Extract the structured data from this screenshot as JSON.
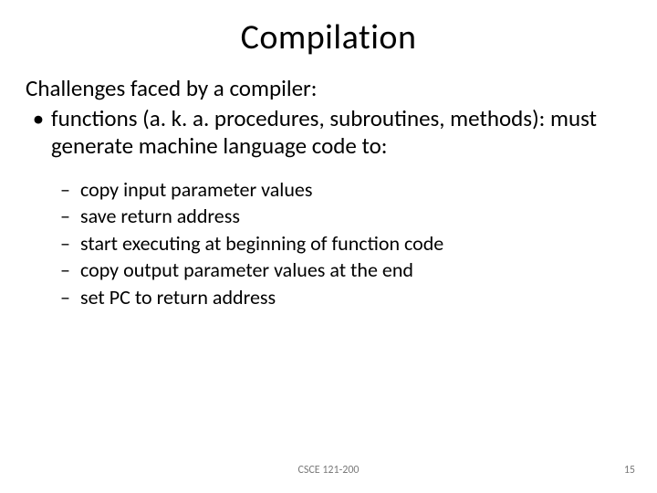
{
  "title": "Compilation",
  "intro": "Challenges faced by a compiler:",
  "bullet": {
    "text": "functions (a. k. a. procedures, subroutines, methods):  must generate machine language code to:"
  },
  "subitems": [
    "copy input parameter values",
    "save return address",
    "start executing at beginning of function code",
    "copy output parameter values at the end",
    "set PC to return address"
  ],
  "footer": "CSCE 121-200",
  "page": "15"
}
